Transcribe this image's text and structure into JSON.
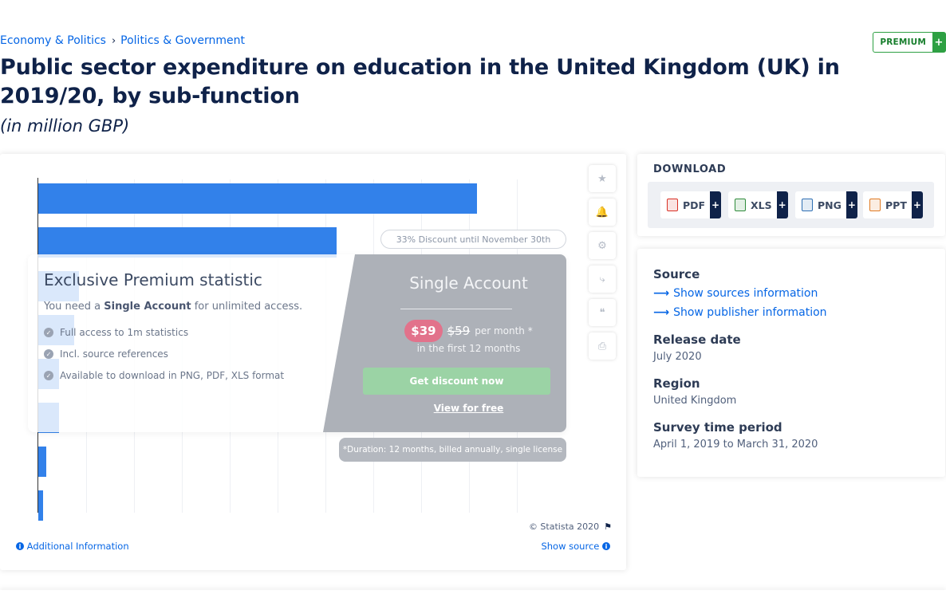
{
  "breadcrumb": {
    "item1": "Economy & Politics",
    "sep": "›",
    "item2": "Politics & Government"
  },
  "premium": {
    "label": "PREMIUM",
    "plus": "+"
  },
  "title": "Public sector expenditure on education in the United Kingdom (UK) in 2019/20, by sub-function",
  "unit": "(in million GBP)",
  "chart_data": {
    "type": "bar",
    "orientation": "horizontal",
    "values_obscured": true,
    "visible_bar_relative_lengths": [
      0.86,
      0.585,
      0.08,
      0.07,
      0.04,
      0.04,
      0.015,
      0.01
    ],
    "colors": {
      "bar": "#3281ea"
    }
  },
  "overlay": {
    "title": "Exclusive Premium statistic",
    "need_prefix": "You need a",
    "need_bold": "Single Account",
    "need_suffix": "for unlimited access.",
    "features": [
      "Full access to 1m statistics",
      "Incl. source references",
      "Available to download in PNG, PDF, XLS format"
    ],
    "account_title": "Single Account",
    "price_new": "$39",
    "price_old": "$59",
    "price_per": "per month *",
    "price_first": "in the first 12 months",
    "cta": "Get discount now",
    "view_free": "View for free",
    "discount": "33% Discount until November 30th",
    "duration": "*Duration: 12 months, billed annually, single license"
  },
  "toolbar": {
    "star": "★",
    "bell": "🔔",
    "gear": "⚙",
    "share": "⤷",
    "quote": "❝",
    "print": "⎙"
  },
  "chart_footer": {
    "copyright": "© Statista 2020",
    "additional_info": "Additional Information",
    "show_source": "Show source"
  },
  "download": {
    "title": "DOWNLOAD",
    "formats": [
      {
        "label": "PDF",
        "color": "#d93025"
      },
      {
        "label": "XLS",
        "color": "#2e8b3a"
      },
      {
        "label": "PNG",
        "color": "#2f6fb3"
      },
      {
        "label": "PPT",
        "color": "#e07b24"
      }
    ],
    "plus": "+"
  },
  "meta": {
    "source_heading": "Source",
    "sources_link": "Show sources information",
    "publisher_link": "Show publisher information",
    "release_heading": "Release date",
    "release_value": "July 2020",
    "region_heading": "Region",
    "region_value": "United Kingdom",
    "survey_heading": "Survey time period",
    "survey_value": "April 1, 2019 to March 31, 2020"
  },
  "colors": {
    "accent": "#0666e5",
    "navy": "#0f2249",
    "bar": "#3281ea",
    "premium": "#2ea043"
  }
}
